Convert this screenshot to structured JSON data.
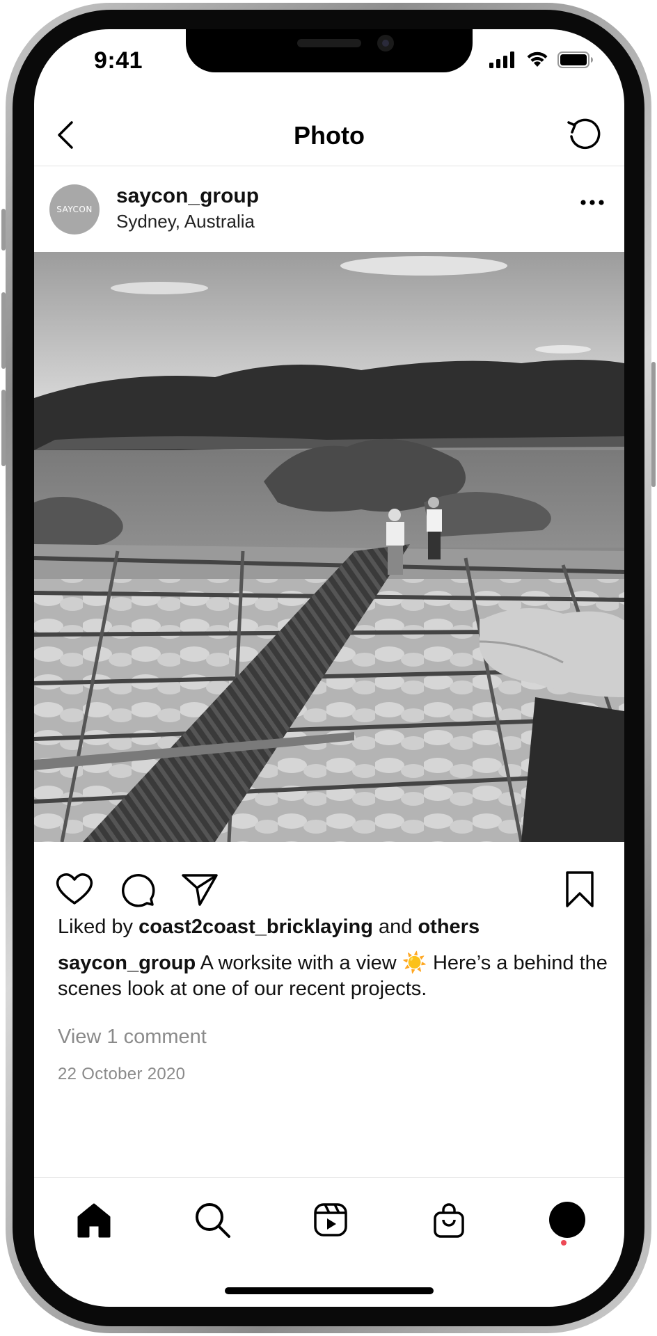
{
  "status_bar": {
    "time": "9:41"
  },
  "nav": {
    "title": "Photo"
  },
  "post": {
    "avatar_text": "SAYCON",
    "username": "saycon_group",
    "location": "Sydney, Australia",
    "likes_prefix": "Liked by ",
    "likes_user": "coast2coast_bricklaying",
    "likes_mid": " and ",
    "likes_others": "others",
    "caption_user": "saycon_group",
    "caption_text": " A worksite with a view ☀️ Here’s a behind the scenes look at one of our recent projects.",
    "view_comments": "View 1 comment",
    "date": "22 October 2020"
  },
  "icons": {
    "back": "chevron-left-icon",
    "refresh": "refresh-icon",
    "more": "more-horizontal-icon",
    "like": "heart-icon",
    "comment": "comment-icon",
    "share": "paper-plane-icon",
    "save": "bookmark-icon",
    "home": "home-icon",
    "search": "search-icon",
    "reels": "reels-icon",
    "shop": "shopping-bag-icon",
    "profile": "profile-icon"
  },
  "colors": {
    "notification_dot": "#ed4956",
    "secondary_text": "#8a8a8a"
  }
}
